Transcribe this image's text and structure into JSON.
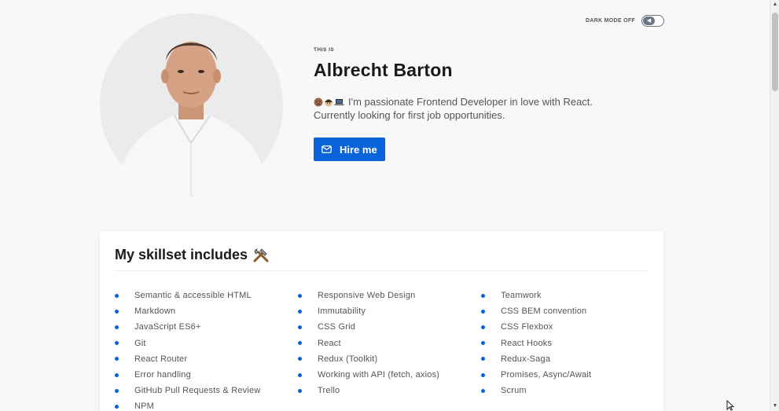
{
  "toggle": {
    "label": "DARK MODE OFF",
    "icon": "speaker-icon"
  },
  "hero": {
    "pre_title": "THIS IS",
    "name": "Albrecht Barton",
    "bio_line1": "I'm passionate Frontend Developer in love with React.",
    "bio_line2": "Currently looking for first job opportunities.",
    "hire_label": "Hire me",
    "hire_icon": "mail-icon"
  },
  "skills": {
    "title": "My skillset includes",
    "title_icon": "tools-icon",
    "columns": [
      [
        "Semantic & accessible HTML",
        "Markdown",
        "JavaScript ES6+",
        "Git",
        "React Router",
        "Error handling",
        "GitHub Pull Requests & Review",
        "NPM"
      ],
      [
        "Responsive Web Design",
        "Immutability",
        "CSS Grid",
        "React",
        "Redux (Toolkit)",
        "Working with API (fetch, axios)",
        "Trello"
      ],
      [
        "Teamwork",
        "CSS BEM convention",
        "CSS Flexbox",
        "React Hooks",
        "Redux-Saga",
        "Promises, Async/Await",
        "Scrum"
      ]
    ]
  },
  "colors": {
    "accent": "#0a63d8",
    "background": "#f8f8f9",
    "text": "#1a1a1a"
  }
}
